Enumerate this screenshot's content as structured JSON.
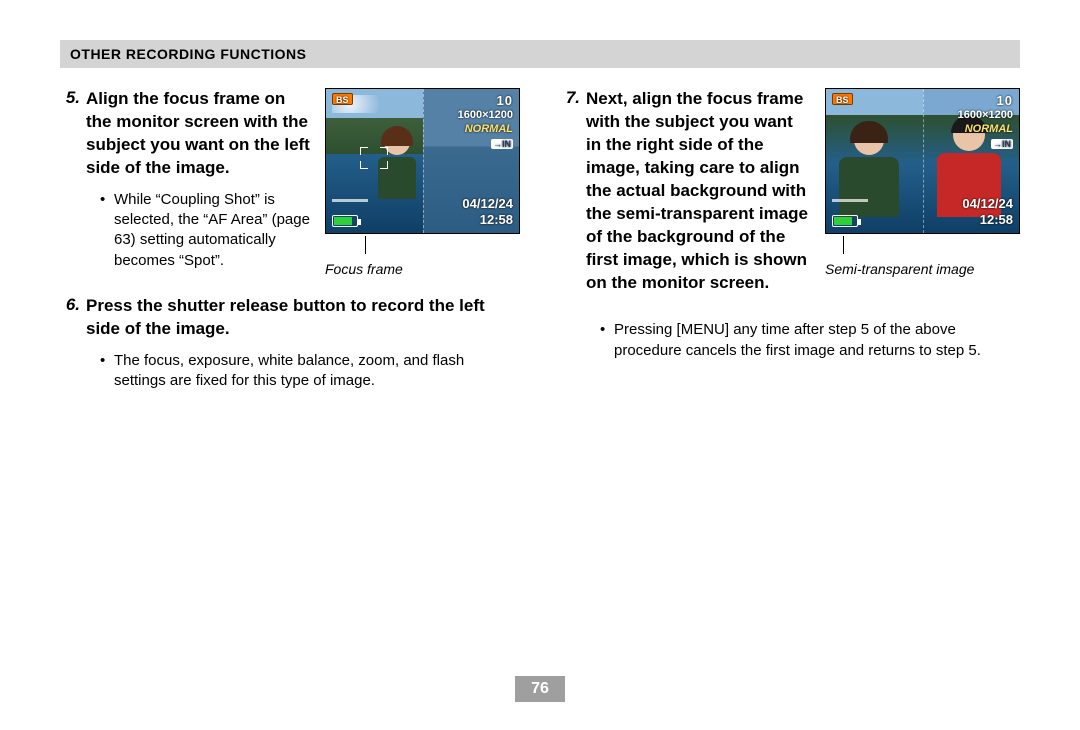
{
  "header": "OTHER RECORDING FUNCTIONS",
  "page_number": "76",
  "left": {
    "step5": {
      "num": "5.",
      "title": "Align the focus frame on the monitor screen with the subject you want on the left side of the image.",
      "bullet1": "While “Coupling Shot” is selected, the “AF Area” (page 63) setting automatically becomes “Spot”."
    },
    "fig1_caption": "Focus frame",
    "step6": {
      "num": "6.",
      "title": "Press the shutter release button to record the left side of the image.",
      "bullet1": "The focus, exposure, white balance, zoom, and flash settings are fixed for this type of image."
    }
  },
  "right": {
    "step7": {
      "num": "7.",
      "title": "Next, align the focus frame with the subject you want in the right side of the image, taking care to align the actual background with the semi-transparent image of the background of the first image, which is shown on the monitor screen.",
      "bullet1": "Pressing [MENU] any time after step 5 of the above procedure cancels the first image and returns to step 5."
    },
    "fig2_caption": "Semi-transparent image"
  },
  "osd": {
    "bs": "BS",
    "count": "10",
    "res": "1600×1200",
    "quality": "NORMAL",
    "mem": "→IN",
    "date": "04/12/24",
    "time": "12:58"
  }
}
